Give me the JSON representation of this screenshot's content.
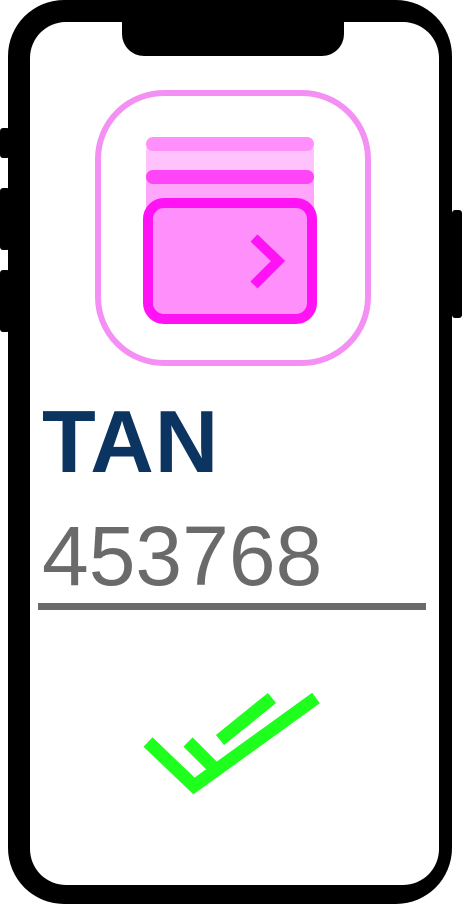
{
  "icons": {
    "app_icon": "stacked-cards-arrow-icon",
    "success": "double-check-icon"
  },
  "tan": {
    "label": "TAN",
    "value": "453768"
  },
  "colors": {
    "frame": "#000000",
    "label": "#0c3461",
    "field_text": "#6a6a6a",
    "icon_outline": "#f490f4",
    "icon_magenta": "#ff13f5",
    "icon_fill": "#ff90fb",
    "check": "#1eff1e"
  }
}
